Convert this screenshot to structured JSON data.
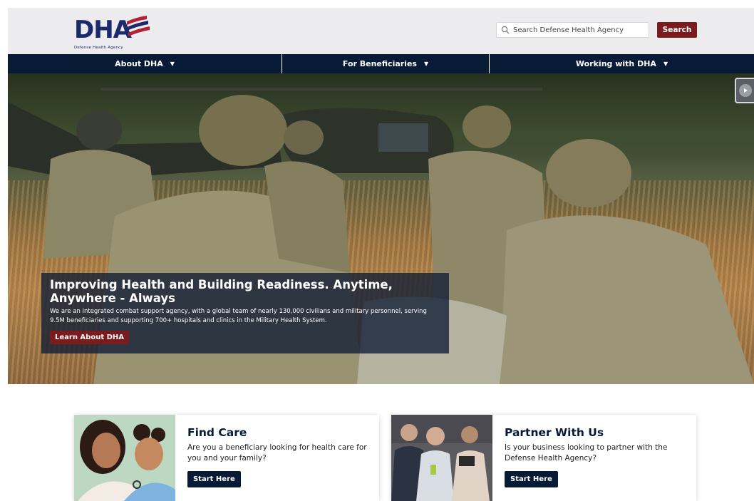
{
  "header": {
    "logo_text": "DHA",
    "logo_tagline": "Defense Health Agency",
    "search_placeholder": "Search Defense Health Agency",
    "search_button": "Search"
  },
  "nav": {
    "items": [
      {
        "label": "About DHA"
      },
      {
        "label": "For Beneficiaries"
      },
      {
        "label": "Working with DHA"
      }
    ]
  },
  "hero": {
    "title": "Improving Health and Building Readiness. Anytime, Anywhere - Always",
    "description": "We are an integrated combat support agency, with a global team of nearly 130,000 civilians and military personnel, serving 9.5M beneficiaries and supporting 700+ hospitals and clinics in the Military Health System.",
    "button": "Learn About DHA"
  },
  "cards": [
    {
      "title": "Find Care",
      "text": "Are you a beneficiary looking for health care for you and your family?",
      "button": "Start Here"
    },
    {
      "title": "Partner With Us",
      "text": "Is your business looking to partner with the Defense Health Agency?",
      "button": "Start Here"
    }
  ],
  "colors": {
    "brand_navy": "#071a36",
    "brand_red": "#7b1b1e",
    "header_bg": "#ececee"
  }
}
